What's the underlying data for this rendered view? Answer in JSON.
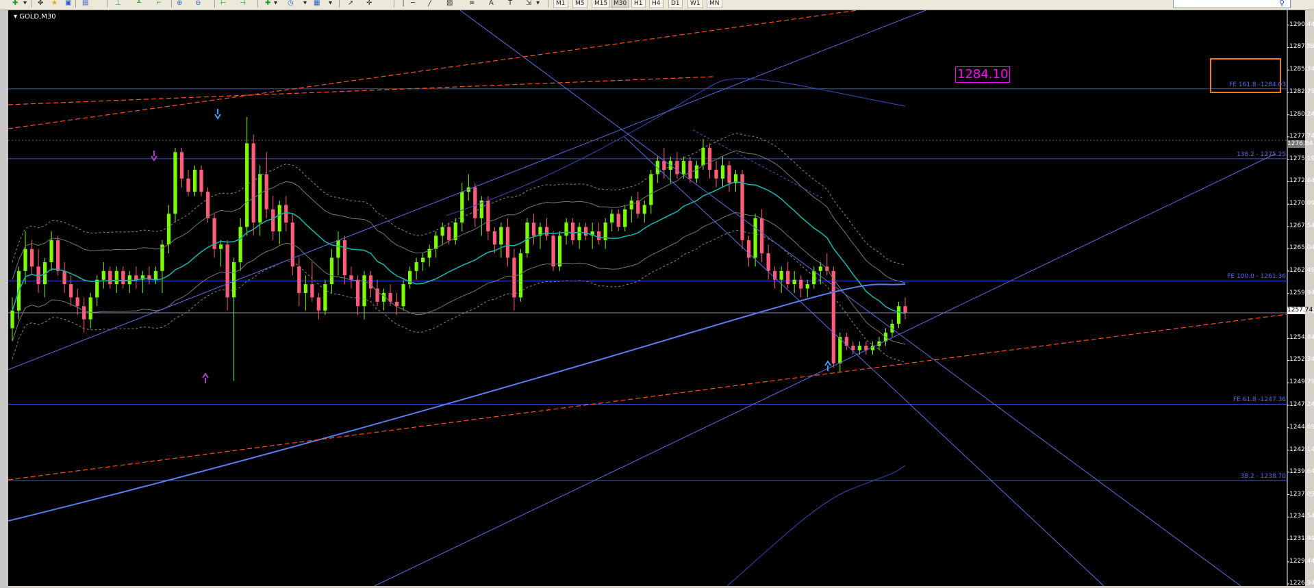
{
  "toolbar": {
    "timeframes": [
      "M1",
      "M5",
      "M15",
      "M30",
      "H1",
      "H4",
      "D1",
      "W1",
      "MN"
    ],
    "draw_tools": [
      "A",
      "T"
    ]
  },
  "chart": {
    "symbol": "GOLD,M30",
    "price_box": "1284.10",
    "current_price": "1257.74",
    "ask_price": "1276.84",
    "colors": {
      "background": "#000000",
      "bull_candle": "#7cfc00",
      "bear_candle": "#ff5c7a",
      "level_line": "#3e52d8",
      "channel_line": "#5a6ee0",
      "fib_dashed": "#ff5020",
      "ma_teal": "#18b0a8",
      "ma_blue": "#5a7cf0",
      "price_box": "#ff00ff",
      "highlight_box": "#f07820"
    },
    "price_axis": [
      "1290.44",
      "1287.89",
      "1285.34",
      "1282.79",
      "1280.24",
      "1277.74",
      "1275.19",
      "1272.64",
      "1270.09",
      "1267.54",
      "1265.04",
      "1262.49",
      "1259.94",
      "1257.74",
      "1254.84",
      "1252.34",
      "1249.79",
      "1247.24",
      "1244.69",
      "1242.14",
      "1239.64",
      "1237.09",
      "1234.54",
      "1231.99",
      "1229.44",
      "1226.94"
    ],
    "levels": [
      {
        "label": "FE 161.8 -1284.03",
        "price": 1283.2
      },
      {
        "label": "138.2 - 1275.25",
        "price": 1275.25
      },
      {
        "label": "FE 100.0 - 1261.36",
        "price": 1261.36
      },
      {
        "label": "FE 61.8 -1247.36",
        "price": 1247.36
      },
      {
        "label": "38.2 - 1238.70",
        "price": 1238.7
      }
    ]
  },
  "chart_data": {
    "type": "candlestick",
    "symbol": "GOLD",
    "timeframe": "M30",
    "ylim": [
      1226.94,
      1291.5
    ],
    "horizontal_levels": [
      1283.2,
      1275.25,
      1261.36,
      1257.74,
      1247.36,
      1238.7
    ],
    "candles": [
      {
        "o": 1256.0,
        "h": 1259.5,
        "l": 1254.5,
        "c": 1258.0
      },
      {
        "o": 1258.0,
        "h": 1263.0,
        "l": 1257.0,
        "c": 1262.5
      },
      {
        "o": 1262.5,
        "h": 1267.0,
        "l": 1261.0,
        "c": 1265.0
      },
      {
        "o": 1265.0,
        "h": 1266.0,
        "l": 1262.0,
        "c": 1263.0
      },
      {
        "o": 1263.0,
        "h": 1265.0,
        "l": 1260.0,
        "c": 1261.0
      },
      {
        "o": 1261.0,
        "h": 1264.0,
        "l": 1259.5,
        "c": 1263.5
      },
      {
        "o": 1263.5,
        "h": 1267.0,
        "l": 1262.5,
        "c": 1266.0
      },
      {
        "o": 1266.0,
        "h": 1266.5,
        "l": 1262.0,
        "c": 1262.5
      },
      {
        "o": 1262.5,
        "h": 1263.5,
        "l": 1260.0,
        "c": 1261.0
      },
      {
        "o": 1261.0,
        "h": 1262.0,
        "l": 1258.5,
        "c": 1259.5
      },
      {
        "o": 1259.5,
        "h": 1260.5,
        "l": 1257.5,
        "c": 1258.5
      },
      {
        "o": 1258.5,
        "h": 1259.5,
        "l": 1255.5,
        "c": 1257.0
      },
      {
        "o": 1257.0,
        "h": 1260.0,
        "l": 1256.0,
        "c": 1259.5
      },
      {
        "o": 1259.5,
        "h": 1262.0,
        "l": 1258.5,
        "c": 1261.5
      },
      {
        "o": 1261.5,
        "h": 1263.5,
        "l": 1260.5,
        "c": 1262.5
      },
      {
        "o": 1262.5,
        "h": 1263.0,
        "l": 1260.5,
        "c": 1261.0
      },
      {
        "o": 1261.0,
        "h": 1263.0,
        "l": 1260.0,
        "c": 1262.5
      },
      {
        "o": 1262.5,
        "h": 1263.0,
        "l": 1260.5,
        "c": 1261.0
      },
      {
        "o": 1261.0,
        "h": 1262.5,
        "l": 1260.0,
        "c": 1262.0
      },
      {
        "o": 1262.0,
        "h": 1263.0,
        "l": 1260.5,
        "c": 1261.5
      },
      {
        "o": 1261.5,
        "h": 1262.5,
        "l": 1260.0,
        "c": 1262.0
      },
      {
        "o": 1262.0,
        "h": 1263.0,
        "l": 1261.0,
        "c": 1261.5
      },
      {
        "o": 1261.5,
        "h": 1263.0,
        "l": 1261.0,
        "c": 1262.5
      },
      {
        "o": 1262.5,
        "h": 1266.0,
        "l": 1260.0,
        "c": 1265.5
      },
      {
        "o": 1265.5,
        "h": 1270.0,
        "l": 1264.5,
        "c": 1269.0
      },
      {
        "o": 1269.0,
        "h": 1276.5,
        "l": 1268.0,
        "c": 1276.0
      },
      {
        "o": 1276.0,
        "h": 1276.5,
        "l": 1272.0,
        "c": 1273.0
      },
      {
        "o": 1273.0,
        "h": 1274.0,
        "l": 1271.0,
        "c": 1271.5
      },
      {
        "o": 1271.5,
        "h": 1274.5,
        "l": 1271.0,
        "c": 1274.0
      },
      {
        "o": 1274.0,
        "h": 1274.5,
        "l": 1271.0,
        "c": 1271.5
      },
      {
        "o": 1271.5,
        "h": 1272.0,
        "l": 1268.0,
        "c": 1268.5
      },
      {
        "o": 1268.5,
        "h": 1269.0,
        "l": 1264.0,
        "c": 1265.0
      },
      {
        "o": 1265.0,
        "h": 1266.0,
        "l": 1263.0,
        "c": 1265.5
      },
      {
        "o": 1265.5,
        "h": 1266.0,
        "l": 1258.0,
        "c": 1259.5
      },
      {
        "o": 1259.5,
        "h": 1264.0,
        "l": 1250.0,
        "c": 1263.5
      },
      {
        "o": 1263.5,
        "h": 1268.5,
        "l": 1262.5,
        "c": 1267.5
      },
      {
        "o": 1267.5,
        "h": 1280.0,
        "l": 1266.5,
        "c": 1277.0
      },
      {
        "o": 1277.0,
        "h": 1278.0,
        "l": 1266.5,
        "c": 1268.0
      },
      {
        "o": 1268.0,
        "h": 1274.5,
        "l": 1266.5,
        "c": 1273.5
      },
      {
        "o": 1273.5,
        "h": 1276.0,
        "l": 1268.5,
        "c": 1269.5
      },
      {
        "o": 1269.5,
        "h": 1271.0,
        "l": 1266.0,
        "c": 1267.0
      },
      {
        "o": 1267.0,
        "h": 1270.5,
        "l": 1265.5,
        "c": 1270.0
      },
      {
        "o": 1270.0,
        "h": 1271.0,
        "l": 1267.0,
        "c": 1268.0
      },
      {
        "o": 1268.0,
        "h": 1269.0,
        "l": 1262.0,
        "c": 1263.0
      },
      {
        "o": 1263.0,
        "h": 1264.0,
        "l": 1258.5,
        "c": 1260.0
      },
      {
        "o": 1260.0,
        "h": 1262.0,
        "l": 1258.0,
        "c": 1261.0
      },
      {
        "o": 1261.0,
        "h": 1263.5,
        "l": 1259.0,
        "c": 1259.5
      },
      {
        "o": 1259.5,
        "h": 1260.0,
        "l": 1257.0,
        "c": 1258.0
      },
      {
        "o": 1258.0,
        "h": 1261.5,
        "l": 1257.5,
        "c": 1261.0
      },
      {
        "o": 1261.0,
        "h": 1265.0,
        "l": 1260.0,
        "c": 1264.0
      },
      {
        "o": 1264.0,
        "h": 1267.0,
        "l": 1262.0,
        "c": 1266.0
      },
      {
        "o": 1266.0,
        "h": 1266.5,
        "l": 1261.0,
        "c": 1262.0
      },
      {
        "o": 1262.0,
        "h": 1263.0,
        "l": 1260.5,
        "c": 1261.5
      },
      {
        "o": 1261.5,
        "h": 1262.0,
        "l": 1257.5,
        "c": 1258.5
      },
      {
        "o": 1258.5,
        "h": 1262.5,
        "l": 1257.0,
        "c": 1262.0
      },
      {
        "o": 1262.0,
        "h": 1262.5,
        "l": 1259.5,
        "c": 1260.5
      },
      {
        "o": 1260.5,
        "h": 1261.5,
        "l": 1258.5,
        "c": 1259.0
      },
      {
        "o": 1259.0,
        "h": 1260.5,
        "l": 1258.0,
        "c": 1260.0
      },
      {
        "o": 1260.0,
        "h": 1261.0,
        "l": 1258.5,
        "c": 1259.0
      },
      {
        "o": 1259.0,
        "h": 1260.0,
        "l": 1257.5,
        "c": 1258.5
      },
      {
        "o": 1258.5,
        "h": 1261.5,
        "l": 1258.0,
        "c": 1261.0
      },
      {
        "o": 1261.0,
        "h": 1263.0,
        "l": 1260.5,
        "c": 1262.5
      },
      {
        "o": 1262.5,
        "h": 1264.0,
        "l": 1261.5,
        "c": 1263.5
      },
      {
        "o": 1263.5,
        "h": 1264.5,
        "l": 1262.5,
        "c": 1264.0
      },
      {
        "o": 1264.0,
        "h": 1265.5,
        "l": 1263.0,
        "c": 1265.0
      },
      {
        "o": 1265.0,
        "h": 1267.0,
        "l": 1264.0,
        "c": 1266.5
      },
      {
        "o": 1266.5,
        "h": 1268.0,
        "l": 1265.5,
        "c": 1267.5
      },
      {
        "o": 1267.5,
        "h": 1268.0,
        "l": 1265.5,
        "c": 1266.0
      },
      {
        "o": 1266.0,
        "h": 1268.5,
        "l": 1265.5,
        "c": 1268.0
      },
      {
        "o": 1268.0,
        "h": 1272.5,
        "l": 1267.0,
        "c": 1271.5
      },
      {
        "o": 1271.5,
        "h": 1273.5,
        "l": 1270.5,
        "c": 1272.0
      },
      {
        "o": 1272.0,
        "h": 1272.5,
        "l": 1267.5,
        "c": 1268.5
      },
      {
        "o": 1268.5,
        "h": 1271.0,
        "l": 1266.5,
        "c": 1270.5
      },
      {
        "o": 1270.5,
        "h": 1271.0,
        "l": 1266.0,
        "c": 1267.0
      },
      {
        "o": 1267.0,
        "h": 1267.5,
        "l": 1264.5,
        "c": 1265.5
      },
      {
        "o": 1265.5,
        "h": 1268.0,
        "l": 1264.0,
        "c": 1267.5
      },
      {
        "o": 1267.5,
        "h": 1268.5,
        "l": 1263.0,
        "c": 1264.0
      },
      {
        "o": 1264.0,
        "h": 1265.0,
        "l": 1258.0,
        "c": 1259.5
      },
      {
        "o": 1259.5,
        "h": 1265.0,
        "l": 1259.0,
        "c": 1264.5
      },
      {
        "o": 1264.5,
        "h": 1268.5,
        "l": 1264.0,
        "c": 1268.0
      },
      {
        "o": 1268.0,
        "h": 1269.0,
        "l": 1265.5,
        "c": 1266.5
      },
      {
        "o": 1266.5,
        "h": 1268.0,
        "l": 1265.0,
        "c": 1267.5
      },
      {
        "o": 1267.5,
        "h": 1268.5,
        "l": 1266.0,
        "c": 1266.5
      },
      {
        "o": 1266.5,
        "h": 1267.0,
        "l": 1262.5,
        "c": 1263.0
      },
      {
        "o": 1263.0,
        "h": 1267.0,
        "l": 1262.5,
        "c": 1266.5
      },
      {
        "o": 1266.5,
        "h": 1268.5,
        "l": 1265.5,
        "c": 1268.0
      },
      {
        "o": 1268.0,
        "h": 1268.5,
        "l": 1265.5,
        "c": 1266.0
      },
      {
        "o": 1266.0,
        "h": 1268.0,
        "l": 1265.0,
        "c": 1267.5
      },
      {
        "o": 1267.5,
        "h": 1268.0,
        "l": 1266.0,
        "c": 1266.5
      },
      {
        "o": 1266.5,
        "h": 1268.0,
        "l": 1265.0,
        "c": 1267.0
      },
      {
        "o": 1267.0,
        "h": 1268.0,
        "l": 1265.5,
        "c": 1266.0
      },
      {
        "o": 1266.0,
        "h": 1268.5,
        "l": 1265.0,
        "c": 1268.0
      },
      {
        "o": 1268.0,
        "h": 1269.5,
        "l": 1267.0,
        "c": 1269.0
      },
      {
        "o": 1269.0,
        "h": 1269.5,
        "l": 1267.0,
        "c": 1267.5
      },
      {
        "o": 1267.5,
        "h": 1270.0,
        "l": 1267.0,
        "c": 1269.5
      },
      {
        "o": 1269.5,
        "h": 1271.0,
        "l": 1268.0,
        "c": 1270.5
      },
      {
        "o": 1270.5,
        "h": 1271.5,
        "l": 1268.5,
        "c": 1269.0
      },
      {
        "o": 1269.0,
        "h": 1270.5,
        "l": 1268.0,
        "c": 1270.0
      },
      {
        "o": 1270.0,
        "h": 1274.0,
        "l": 1269.0,
        "c": 1273.5
      },
      {
        "o": 1273.5,
        "h": 1275.5,
        "l": 1272.5,
        "c": 1275.0
      },
      {
        "o": 1275.0,
        "h": 1276.5,
        "l": 1273.0,
        "c": 1274.0
      },
      {
        "o": 1274.0,
        "h": 1275.5,
        "l": 1272.5,
        "c": 1275.0
      },
      {
        "o": 1275.0,
        "h": 1276.0,
        "l": 1273.0,
        "c": 1273.5
      },
      {
        "o": 1273.5,
        "h": 1275.5,
        "l": 1273.0,
        "c": 1275.0
      },
      {
        "o": 1275.0,
        "h": 1275.5,
        "l": 1272.5,
        "c": 1273.0
      },
      {
        "o": 1273.0,
        "h": 1275.0,
        "l": 1272.5,
        "c": 1274.5
      },
      {
        "o": 1274.5,
        "h": 1277.5,
        "l": 1274.0,
        "c": 1276.5
      },
      {
        "o": 1276.5,
        "h": 1277.0,
        "l": 1273.0,
        "c": 1274.0
      },
      {
        "o": 1274.0,
        "h": 1275.0,
        "l": 1272.0,
        "c": 1273.0
      },
      {
        "o": 1273.0,
        "h": 1275.5,
        "l": 1272.0,
        "c": 1274.5
      },
      {
        "o": 1274.5,
        "h": 1275.0,
        "l": 1271.5,
        "c": 1272.5
      },
      {
        "o": 1272.5,
        "h": 1274.0,
        "l": 1271.5,
        "c": 1273.5
      },
      {
        "o": 1273.5,
        "h": 1274.0,
        "l": 1265.0,
        "c": 1266.0
      },
      {
        "o": 1266.0,
        "h": 1266.5,
        "l": 1263.0,
        "c": 1264.0
      },
      {
        "o": 1264.0,
        "h": 1269.0,
        "l": 1263.0,
        "c": 1268.5
      },
      {
        "o": 1268.5,
        "h": 1269.5,
        "l": 1263.5,
        "c": 1264.5
      },
      {
        "o": 1264.5,
        "h": 1265.5,
        "l": 1261.5,
        "c": 1262.5
      },
      {
        "o": 1262.5,
        "h": 1263.0,
        "l": 1260.5,
        "c": 1261.5
      },
      {
        "o": 1261.5,
        "h": 1263.0,
        "l": 1260.0,
        "c": 1262.5
      },
      {
        "o": 1262.5,
        "h": 1263.5,
        "l": 1260.5,
        "c": 1261.0
      },
      {
        "o": 1261.0,
        "h": 1262.5,
        "l": 1260.0,
        "c": 1261.5
      },
      {
        "o": 1261.5,
        "h": 1262.0,
        "l": 1259.5,
        "c": 1260.5
      },
      {
        "o": 1260.5,
        "h": 1261.5,
        "l": 1259.5,
        "c": 1261.0
      },
      {
        "o": 1261.0,
        "h": 1263.0,
        "l": 1260.5,
        "c": 1262.5
      },
      {
        "o": 1262.5,
        "h": 1263.5,
        "l": 1261.0,
        "c": 1263.0
      },
      {
        "o": 1263.0,
        "h": 1264.5,
        "l": 1262.0,
        "c": 1262.5
      },
      {
        "o": 1262.5,
        "h": 1263.0,
        "l": 1251.5,
        "c": 1252.0
      },
      {
        "o": 1252.0,
        "h": 1255.5,
        "l": 1251.0,
        "c": 1255.0
      },
      {
        "o": 1255.0,
        "h": 1255.5,
        "l": 1253.5,
        "c": 1254.0
      },
      {
        "o": 1254.0,
        "h": 1254.5,
        "l": 1253.0,
        "c": 1253.5
      },
      {
        "o": 1253.5,
        "h": 1254.5,
        "l": 1253.0,
        "c": 1254.0
      },
      {
        "o": 1254.0,
        "h": 1254.5,
        "l": 1253.0,
        "c": 1253.5
      },
      {
        "o": 1253.5,
        "h": 1254.5,
        "l": 1253.0,
        "c": 1254.0
      },
      {
        "o": 1254.0,
        "h": 1255.0,
        "l": 1253.5,
        "c": 1254.5
      },
      {
        "o": 1254.5,
        "h": 1256.0,
        "l": 1254.0,
        "c": 1255.5
      },
      {
        "o": 1255.5,
        "h": 1257.0,
        "l": 1255.0,
        "c": 1256.5
      },
      {
        "o": 1256.5,
        "h": 1259.0,
        "l": 1256.0,
        "c": 1258.5
      },
      {
        "o": 1258.5,
        "h": 1259.5,
        "l": 1257.0,
        "c": 1257.74
      }
    ]
  }
}
